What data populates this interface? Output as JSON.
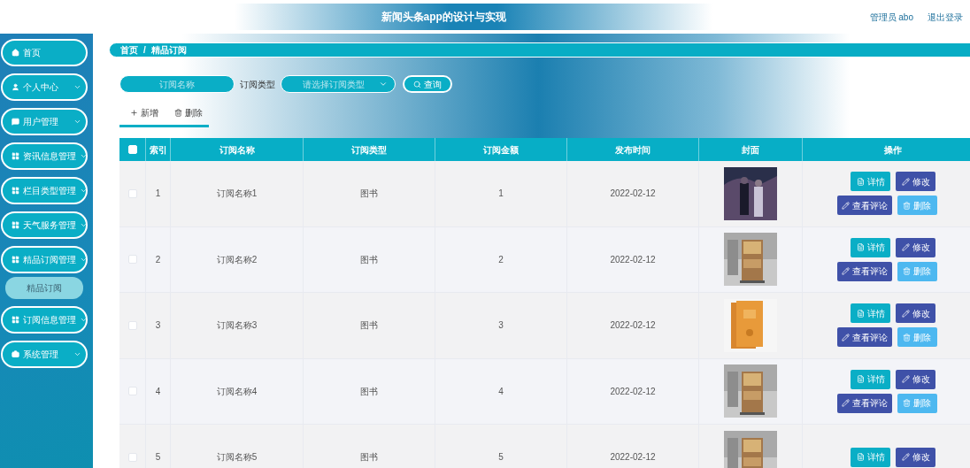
{
  "header": {
    "title": "新闻头条app的设计与实现",
    "user": "管理员 abo",
    "logout": "退出登录"
  },
  "sidebar": {
    "items": [
      {
        "label": "首页",
        "has_caret": false
      },
      {
        "label": "个人中心",
        "has_caret": true
      },
      {
        "label": "用户管理",
        "has_caret": true
      },
      {
        "label": "资讯信息管理",
        "has_caret": true
      },
      {
        "label": "栏目类型管理",
        "has_caret": true
      },
      {
        "label": "天气服务管理",
        "has_caret": true
      },
      {
        "label": "精品订阅管理",
        "has_caret": true,
        "children": [
          {
            "label": "精品订阅",
            "selected": true
          }
        ]
      },
      {
        "label": "订阅信息管理",
        "has_caret": true
      },
      {
        "label": "系统管理",
        "has_caret": true
      }
    ]
  },
  "breadcrumb": {
    "items": [
      "首页",
      "精品订阅"
    ],
    "separator": "/"
  },
  "search": {
    "name_placeholder": "订阅名称",
    "type_label": "订阅类型",
    "type_placeholder": "请选择订阅类型",
    "button": "查询"
  },
  "actions": [
    {
      "kind": "add",
      "label": "新增"
    },
    {
      "kind": "delete",
      "label": "删除"
    }
  ],
  "table": {
    "header_checked": false,
    "columns": [
      "索引",
      "订阅名称",
      "订阅类型",
      "订阅金额",
      "发布时间",
      "封面",
      "操作"
    ],
    "rows": [
      {
        "checked": false,
        "index": "1",
        "name": "订阅名称1",
        "type": "图书",
        "amount": "1",
        "date": "2022-02-12",
        "cover": {
          "kind": "picture"
        },
        "buttons": [
          "详情",
          "修改",
          "查看评论",
          "删除"
        ]
      },
      {
        "checked": false,
        "index": "2",
        "name": "订阅名称2",
        "type": "图书",
        "amount": "2",
        "date": "2022-02-12",
        "cover": {
          "kind": "picture"
        },
        "buttons": [
          "详情",
          "修改",
          "查看评论",
          "删除"
        ]
      },
      {
        "checked": false,
        "index": "3",
        "name": "订阅名称3",
        "type": "图书",
        "amount": "3",
        "date": "2022-02-12",
        "cover": {
          "kind": "picture"
        },
        "buttons": [
          "详情",
          "修改",
          "查看评论",
          "删除"
        ]
      },
      {
        "checked": false,
        "index": "4",
        "name": "订阅名称4",
        "type": "图书",
        "amount": "4",
        "date": "2022-02-12",
        "cover": {
          "kind": "picture"
        },
        "buttons": [
          "详情",
          "修改",
          "查看评论",
          "删除"
        ]
      },
      {
        "checked": false,
        "index": "5",
        "name": "订阅名称5",
        "type": "图书",
        "amount": "5",
        "date": "2022-02-12",
        "cover": {
          "kind": "picture"
        },
        "buttons": [
          "详情",
          "修改"
        ]
      }
    ]
  }
}
